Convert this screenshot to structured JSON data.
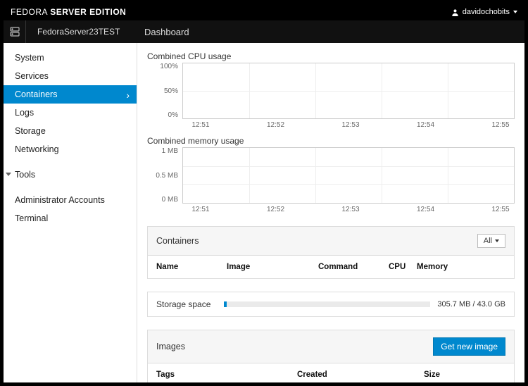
{
  "brand": {
    "light": "FEDORA ",
    "bold": "SERVER EDITION"
  },
  "user": {
    "name": "davidochobits"
  },
  "host": {
    "name": "FedoraServer23TEST"
  },
  "page": {
    "title": "Dashboard"
  },
  "nav": {
    "items": [
      "System",
      "Services",
      "Containers",
      "Logs",
      "Storage",
      "Networking"
    ],
    "active_index": 2,
    "group": "Tools",
    "sub": [
      "Administrator Accounts",
      "Terminal"
    ]
  },
  "chart_data": [
    {
      "type": "line",
      "title": "Combined CPU usage",
      "x": [
        "12:51",
        "12:52",
        "12:53",
        "12:54",
        "12:55"
      ],
      "y_ticks": [
        "100%",
        "50%",
        "0%"
      ],
      "ylim": [
        0,
        100
      ],
      "series": [
        {
          "name": "cpu",
          "values": [
            0,
            0,
            0,
            0,
            0
          ]
        }
      ]
    },
    {
      "type": "line",
      "title": "Combined memory usage",
      "x": [
        "12:51",
        "12:52",
        "12:53",
        "12:54",
        "12:55"
      ],
      "y_ticks": [
        "1 MB",
        "0.5 MB",
        "0 MB"
      ],
      "ylim": [
        0,
        1
      ],
      "series": [
        {
          "name": "mem",
          "values": [
            0,
            0,
            0,
            0,
            0
          ]
        }
      ]
    }
  ],
  "containers": {
    "title": "Containers",
    "filter": "All",
    "columns": [
      "Name",
      "Image",
      "Command",
      "CPU",
      "Memory"
    ],
    "rows": []
  },
  "storage": {
    "label": "Storage space",
    "used": "305.7 MB",
    "total": "43.0 GB",
    "text": "305.7 MB / 43.0 GB",
    "percent": 0.7
  },
  "images": {
    "title": "Images",
    "button": "Get new image",
    "columns": [
      "Tags",
      "Created",
      "Size"
    ],
    "rows": []
  }
}
